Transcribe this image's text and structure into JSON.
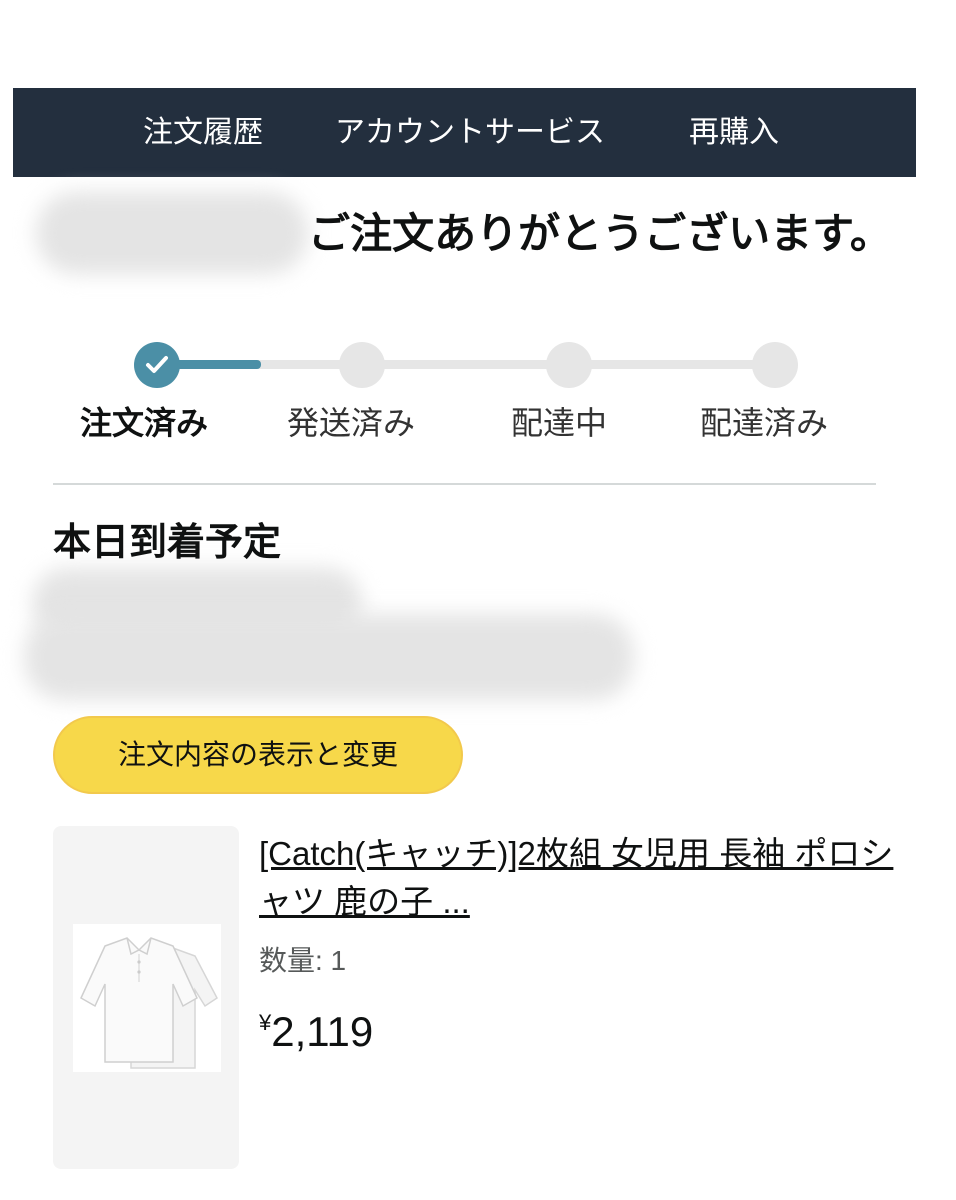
{
  "nav": {
    "items": [
      "注文履歴",
      "アカウントサービス",
      "再購入"
    ],
    "background": "#232f3e"
  },
  "confirmation": {
    "message": "ご注文ありがとうございます。"
  },
  "tracker": {
    "steps": [
      {
        "label": "注文済み",
        "state": "complete"
      },
      {
        "label": "発送済み",
        "state": "pending"
      },
      {
        "label": "配達中",
        "state": "pending"
      },
      {
        "label": "配達済み",
        "state": "pending"
      }
    ],
    "accent": "#4b8fa6"
  },
  "delivery": {
    "heading": "本日到着予定"
  },
  "actions": {
    "view_edit_label": "注文内容の表示と変更",
    "button_color": "#f7d84a"
  },
  "item": {
    "title": "[Catch(キャッチ)]2枚組 女児用 長袖 ポロシャツ 鹿の子 ...",
    "quantity_label": "数量: 1",
    "currency_symbol": "¥",
    "price": "2,119",
    "image_icon": "white-polo-shirt-image"
  }
}
